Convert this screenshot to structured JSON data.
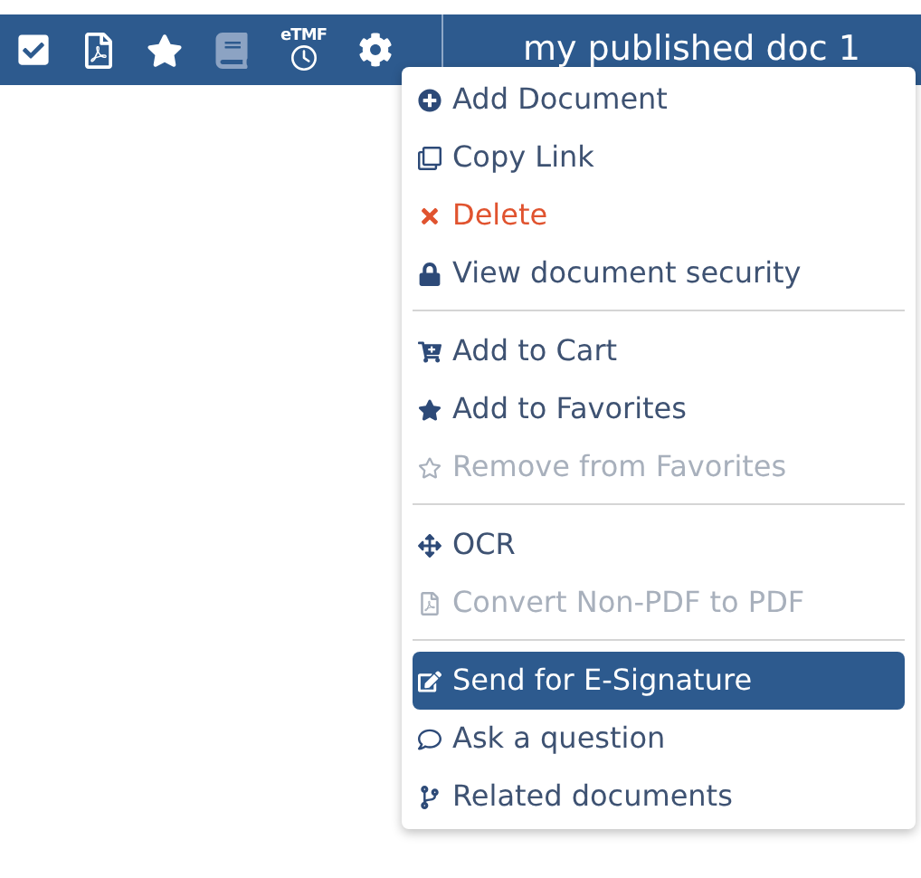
{
  "toolbar": {
    "items": [
      {
        "kind": "checkbox",
        "checked": true,
        "disabled": false
      },
      {
        "kind": "pdf",
        "disabled": false
      },
      {
        "kind": "star",
        "disabled": false
      },
      {
        "kind": "book",
        "disabled": true
      },
      {
        "kind": "etmf",
        "label": "eTMF",
        "disabled": false
      },
      {
        "kind": "gear",
        "disabled": false
      }
    ]
  },
  "document_title": "my published doc 1",
  "menu": {
    "groups": [
      [
        {
          "label": "Add Document",
          "kind": "normal",
          "disabled": false,
          "selected": false
        },
        {
          "label": "Copy Link",
          "kind": "normal",
          "disabled": false,
          "selected": false
        },
        {
          "label": "Delete",
          "kind": "danger",
          "disabled": false,
          "selected": false
        },
        {
          "label": "View document security",
          "kind": "normal",
          "disabled": false,
          "selected": false
        }
      ],
      [
        {
          "label": "Add to Cart",
          "kind": "normal",
          "disabled": false,
          "selected": false
        },
        {
          "label": "Add to Favorites",
          "kind": "normal",
          "disabled": false,
          "selected": false
        },
        {
          "label": "Remove from Favorites",
          "kind": "normal",
          "disabled": true,
          "selected": false
        }
      ],
      [
        {
          "label": "OCR",
          "kind": "normal",
          "disabled": false,
          "selected": false
        },
        {
          "label": "Convert Non-PDF to PDF",
          "kind": "normal",
          "disabled": true,
          "selected": false
        }
      ],
      [
        {
          "label": "Send for E-Signature",
          "kind": "normal",
          "disabled": false,
          "selected": true
        },
        {
          "label": "Ask a question",
          "kind": "normal",
          "disabled": false,
          "selected": false
        },
        {
          "label": "Related documents",
          "kind": "normal",
          "disabled": false,
          "selected": false
        }
      ]
    ]
  }
}
